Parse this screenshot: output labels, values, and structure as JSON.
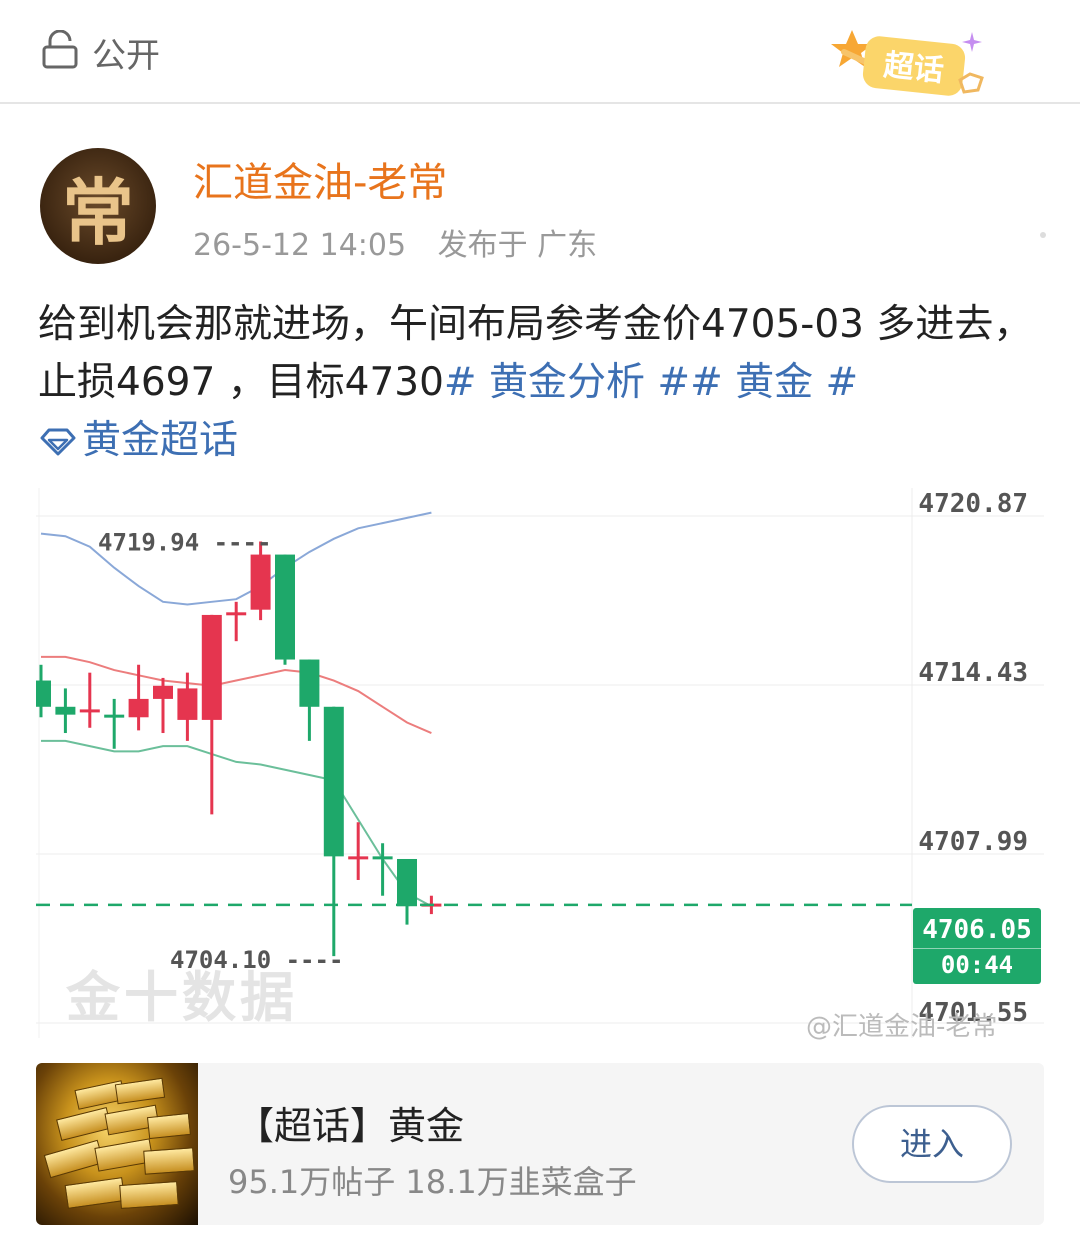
{
  "header": {
    "visibility_label": "公开",
    "lock_icon": "lock-icon",
    "supertopic_badge_label": "超话"
  },
  "author": {
    "avatar_char": "常",
    "name": "汇道金油-老常",
    "time": "26-5-12 14:05",
    "location": "发布于 广东"
  },
  "post": {
    "text_before": "给到机会那就进场，午间布局参考金价4705-03 多进去，止损4697 ，目标4730",
    "hashtag_1": "# 黄金分析 #",
    "hashtag_2": "# 黄金 #",
    "supertopic_tag": "黄金超话",
    "supertopic_icon": "diamond-icon"
  },
  "chart_data": {
    "type": "candlestick",
    "y_ticks": [
      "4720.87",
      "4714.43",
      "4707.99",
      "4701.55"
    ],
    "ylim": [
      4701.55,
      4722.5
    ],
    "high_label": "4719.94",
    "low_label": "4704.10",
    "current_price": "4706.05",
    "countdown": "00:44",
    "watermark": "金十数据",
    "weibo_watermark": "@汇道金油-老常",
    "colors": {
      "up": "#e5354f",
      "down": "#1ea86a",
      "upper_band": "#8aa8d8",
      "middle_band": "#ec7d7d",
      "lower_band": "#6bbf9a"
    },
    "candles": [
      {
        "o": 4714.6,
        "h": 4715.2,
        "l": 4713.2,
        "c": 4713.6
      },
      {
        "o": 4713.6,
        "h": 4714.3,
        "l": 4712.6,
        "c": 4713.3
      },
      {
        "o": 4713.5,
        "h": 4714.9,
        "l": 4712.8,
        "c": 4713.5
      },
      {
        "o": 4713.3,
        "h": 4713.9,
        "l": 4712.0,
        "c": 4713.2
      },
      {
        "o": 4713.2,
        "h": 4715.2,
        "l": 4712.7,
        "c": 4713.9
      },
      {
        "o": 4713.9,
        "h": 4714.7,
        "l": 4712.6,
        "c": 4714.4
      },
      {
        "o": 4713.1,
        "h": 4714.9,
        "l": 4712.3,
        "c": 4714.3
      },
      {
        "o": 4713.1,
        "h": 4717.1,
        "l": 4709.5,
        "c": 4717.1
      },
      {
        "o": 4717.2,
        "h": 4717.6,
        "l": 4716.1,
        "c": 4717.2
      },
      {
        "o": 4717.3,
        "h": 4719.9,
        "l": 4716.9,
        "c": 4719.4
      },
      {
        "o": 4719.4,
        "h": 4719.4,
        "l": 4715.2,
        "c": 4715.4
      },
      {
        "o": 4715.4,
        "h": 4715.4,
        "l": 4712.3,
        "c": 4713.6
      },
      {
        "o": 4713.6,
        "h": 4713.6,
        "l": 4704.1,
        "c": 4707.9
      },
      {
        "o": 4707.9,
        "h": 4709.2,
        "l": 4707.0,
        "c": 4707.9
      },
      {
        "o": 4707.9,
        "h": 4708.4,
        "l": 4706.4,
        "c": 4707.8
      },
      {
        "o": 4707.8,
        "h": 4707.8,
        "l": 4705.3,
        "c": 4706.0
      },
      {
        "o": 4706.0,
        "h": 4706.4,
        "l": 4705.7,
        "c": 4706.1
      }
    ],
    "upper_band": [
      4720.2,
      4720.1,
      4719.7,
      4718.9,
      4718.2,
      4717.6,
      4717.5,
      4717.6,
      4717.7,
      4718.2,
      4718.9,
      4719.5,
      4720.0,
      4720.4,
      4720.6,
      4720.8,
      4721.0
    ],
    "middle_band": [
      4715.5,
      4715.5,
      4715.3,
      4715.0,
      4714.8,
      4714.6,
      4714.5,
      4714.4,
      4714.6,
      4714.8,
      4715.0,
      4714.9,
      4714.6,
      4714.2,
      4713.6,
      4713.0,
      4712.6
    ],
    "lower_band": [
      4712.3,
      4712.3,
      4712.1,
      4711.9,
      4711.9,
      4712.1,
      4712.1,
      4711.8,
      4711.5,
      4711.4,
      4711.2,
      4711.0,
      4710.8,
      4709.3,
      4707.8,
      4706.5,
      4706.0
    ]
  },
  "topic_card": {
    "title": "【超话】黄金",
    "stats": "95.1万帖子 18.1万韭菜盒子",
    "enter_label": "进入"
  }
}
